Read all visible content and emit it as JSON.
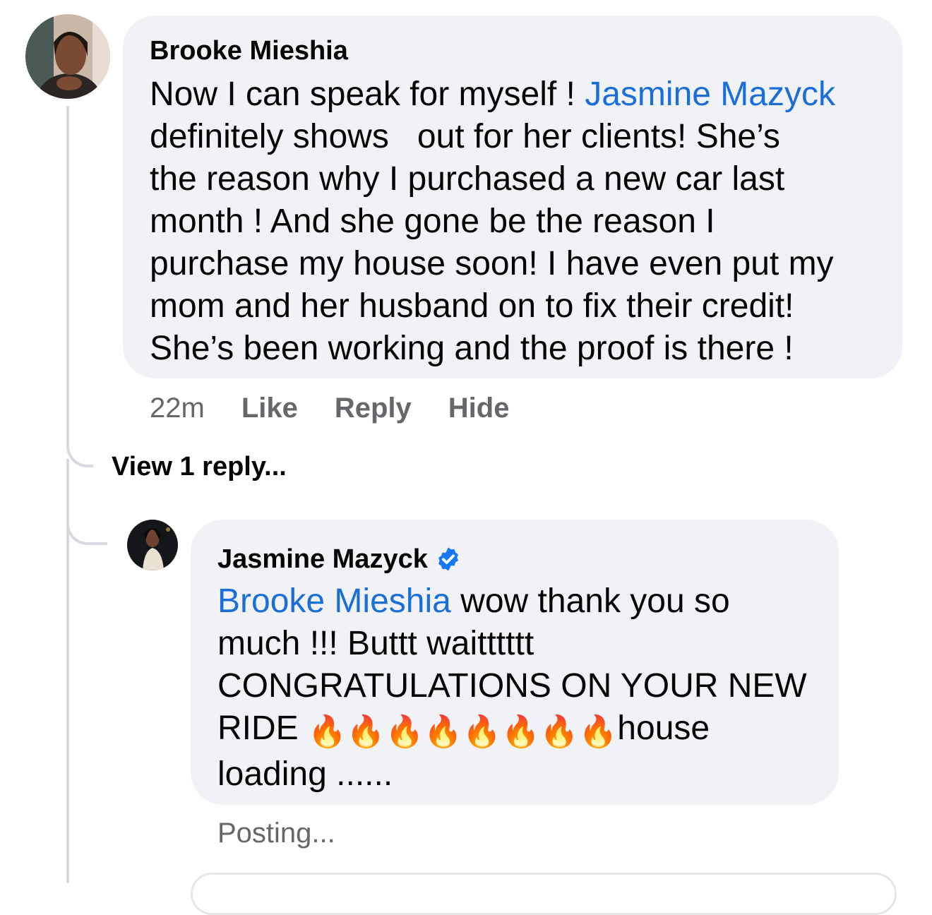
{
  "comment": {
    "author": "Brooke Mieshia",
    "text_before": "Now I can speak for myself ! ",
    "mention": "Jasmine Mazyck",
    "text_after": "\ndefinitely shows   out for her clients! She’s\nthe reason why I purchased a new car last\nmonth ! And she gone be the reason I\npurchase my house soon! I have even put my\nmom and her husband on to fix their credit!\nShe’s been working and the proof is there !",
    "time": "22m",
    "like_label": "Like",
    "reply_label": "Reply",
    "hide_label": "Hide"
  },
  "view_replies": "View 1 reply...",
  "reply": {
    "author": "Jasmine Mazyck",
    "verified": true,
    "mention": "Brooke Mieshia",
    "text_line1": " wow thank you so",
    "text_middle": "much !!! Buttt waitttttt\nCONGRATULATIONS ON YOUR NEW\nRIDE ",
    "fire_emoji": "🔥🔥🔥🔥🔥🔥🔥🔥",
    "text_end": "house\nloading ......",
    "status": "Posting..."
  },
  "colors": {
    "mention": "#1a6ed8",
    "bubble": "#f0f2f5",
    "secondary_text": "#65676b",
    "verified_badge": "#1877f2"
  }
}
